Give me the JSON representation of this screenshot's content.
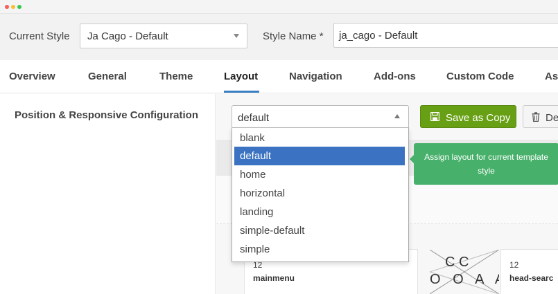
{
  "style_bar": {
    "current_style_label": "Current Style",
    "current_style_value": "Ja Cago - Default",
    "style_name_label": "Style Name *",
    "style_name_value": "ja_cago - Default"
  },
  "tabs": [
    {
      "label": "Overview"
    },
    {
      "label": "General"
    },
    {
      "label": "Theme"
    },
    {
      "label": "Layout",
      "active": true
    },
    {
      "label": "Navigation"
    },
    {
      "label": "Add-ons"
    },
    {
      "label": "Custom Code"
    },
    {
      "label": "As"
    }
  ],
  "section": {
    "title": "Position & Responsive Configuration"
  },
  "layout_select": {
    "value": "default",
    "options": [
      "blank",
      "default",
      "home",
      "horizontal",
      "landing",
      "simple-default",
      "simple"
    ],
    "selected_index": 1
  },
  "buttons": {
    "save_copy": "Save as Copy",
    "delete": "De"
  },
  "tooltip": {
    "text": "Assign layout for current template style"
  },
  "cards": [
    {
      "span": "12",
      "position": "mainmenu"
    },
    {
      "span": "12",
      "position": "head-searc"
    }
  ],
  "logo_letters": {
    "row1": "C C",
    "row2": "O O A A"
  },
  "colors": {
    "accent_blue": "#3b73c2",
    "save_green": "#68a015",
    "tooltip_green": "#47b06a"
  }
}
